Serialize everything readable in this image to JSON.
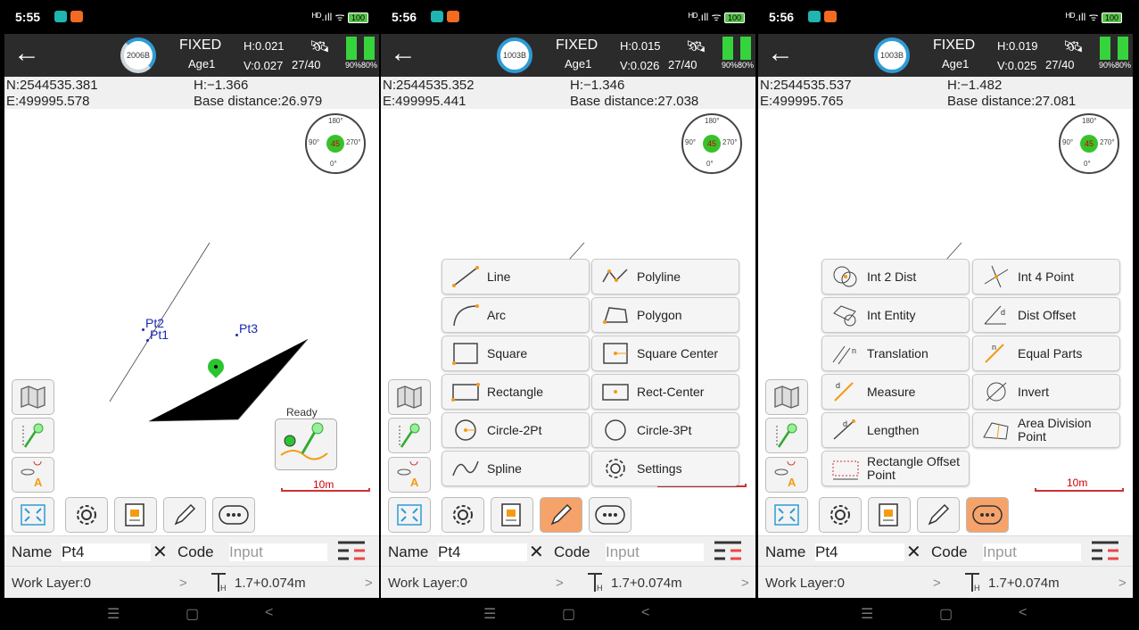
{
  "colors": {
    "accent_active": "#f5a36b",
    "ring": "#2e9bd6",
    "battery_green": "#36d33c",
    "point_label": "#1a2ab3",
    "scale_red": "#cc3333"
  },
  "panels": [
    {
      "status": {
        "time": "5:55",
        "signal": "ᴴᴰ.ıll ᯤ",
        "battery": "100"
      },
      "header": {
        "ring_label": "2006B",
        "fix": "FIXED",
        "age": "Age1",
        "h": "H:0.021",
        "v": "V:0.027",
        "sats": "27/40",
        "battery_levels": "90%80%"
      },
      "coords": {
        "n": "N:2544535.381",
        "e": "E:499995.578",
        "h": "H:−1.366",
        "base": "Base distance:26.979"
      },
      "compass": {
        "top": "180°",
        "left": "90°",
        "right": "270°",
        "center": "45",
        "bottom": "0°"
      },
      "map": {
        "points": [
          "Pt2",
          "Pt1",
          "Pt3"
        ],
        "status": "Ready",
        "scale": "10m"
      },
      "name_bar": {
        "name_label": "Name",
        "name_value": "Pt4",
        "code_label": "Code",
        "code_placeholder": "Input"
      },
      "layer_bar": {
        "layer": "Work Layer:0",
        "height": "1.7+0.074m"
      }
    },
    {
      "status": {
        "time": "5:56",
        "signal": "ᴴᴰ.ıll ᯤ",
        "battery": "100"
      },
      "header": {
        "ring_label": "1003B",
        "fix": "FIXED",
        "age": "Age1",
        "h": "H:0.015",
        "v": "V:0.026",
        "sats": "27/40",
        "battery_levels": "90%80%"
      },
      "coords": {
        "n": "N:2544535.352",
        "e": "E:499995.441",
        "h": "H:−1.346",
        "base": "Base distance:27.038"
      },
      "compass": {
        "top": "180°",
        "left": "90°",
        "right": "270°",
        "center": "45",
        "bottom": "0°"
      },
      "map": {
        "scale": ""
      },
      "menu": [
        "Line",
        "Polyline",
        "Arc",
        "Polygon",
        "Square",
        "Square Center",
        "Rectangle",
        "Rect-Center",
        "Circle-2Pt",
        "Circle-3Pt",
        "Spline",
        "Settings"
      ],
      "name_bar": {
        "name_label": "Name",
        "name_value": "Pt4",
        "code_label": "Code",
        "code_placeholder": "Input"
      },
      "layer_bar": {
        "layer": "Work Layer:0",
        "height": "1.7+0.074m"
      }
    },
    {
      "status": {
        "time": "5:56",
        "signal": "ᴴᴰ.ıll ᯤ",
        "battery": "100"
      },
      "header": {
        "ring_label": "1003B",
        "fix": "FIXED",
        "age": "Age1",
        "h": "H:0.019",
        "v": "V:0.025",
        "sats": "27/40",
        "battery_levels": "90%80%"
      },
      "coords": {
        "n": "N:2544535.537",
        "e": "E:499995.765",
        "h": "H:−1.482",
        "base": "Base distance:27.081"
      },
      "compass": {
        "top": "180°",
        "left": "90°",
        "right": "270°",
        "center": "45",
        "bottom": "0°"
      },
      "map": {
        "scale": "10m"
      },
      "menu": [
        "Int 2 Dist",
        "Int 4 Point",
        "Int Entity",
        "Dist Offset",
        "Translation",
        "Equal Parts",
        "Measure",
        "Invert",
        "Lengthen",
        "Area Division Point",
        "Rectangle Offset Point"
      ],
      "name_bar": {
        "name_label": "Name",
        "name_value": "Pt4",
        "code_label": "Code",
        "code_placeholder": "Input"
      },
      "layer_bar": {
        "layer": "Work Layer:0",
        "height": "1.7+0.074m"
      }
    }
  ]
}
